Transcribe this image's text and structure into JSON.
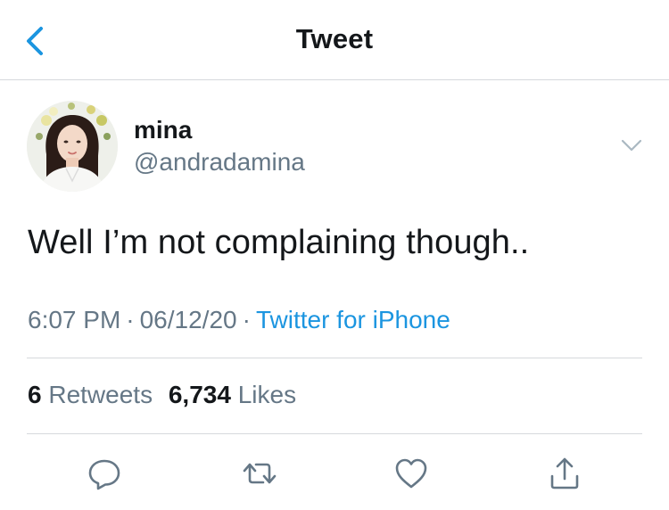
{
  "header": {
    "title": "Tweet",
    "back_icon": "chevron-left-icon"
  },
  "author": {
    "display_name": "mina",
    "handle": "@andradamina",
    "avatar": "profile-photo"
  },
  "tweet": {
    "text": "Well I’m not complaining though..",
    "time": "6:07 PM",
    "date": "06/12/20",
    "separator": "·",
    "source": "Twitter for iPhone"
  },
  "stats": {
    "retweets_count": "6",
    "retweets_label": "Retweets",
    "likes_count": "6,734",
    "likes_label": "Likes"
  },
  "actions": [
    {
      "icon": "reply-icon"
    },
    {
      "icon": "retweet-icon"
    },
    {
      "icon": "like-icon"
    },
    {
      "icon": "share-icon"
    }
  ],
  "colors": {
    "accent": "#1b95e0",
    "secondary_text": "#657786",
    "primary_text": "#14171a",
    "divider": "#d6d9dc"
  }
}
